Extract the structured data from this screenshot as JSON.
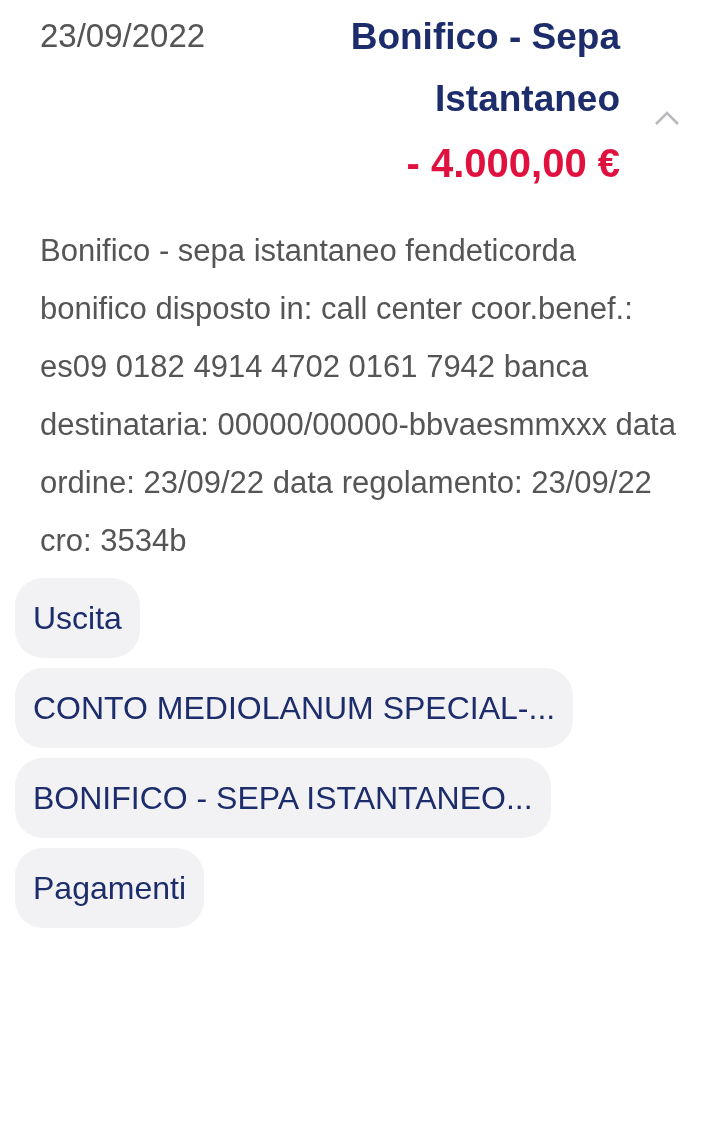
{
  "transaction": {
    "date": "23/09/2022",
    "title": "Bonifico - Sepa Istantaneo",
    "amount": "- 4.000,00 €",
    "expanded": true,
    "description": "Bonifico - sepa istantaneo fendeticorda bonifico disposto in: call center coor.benef.: es09 0182 4914 4702 0161 7942 banca destinataria: 00000/00000-bbvaesmmxxx data ordine: 23/09/22 data regolamento: 23/09/22 cro: 3534b",
    "tags": [
      "Uscita",
      "CONTO MEDIOLANUM SPECIAL-...",
      "BONIFICO - SEPA ISTANTANEO...",
      "Pagamenti"
    ]
  }
}
